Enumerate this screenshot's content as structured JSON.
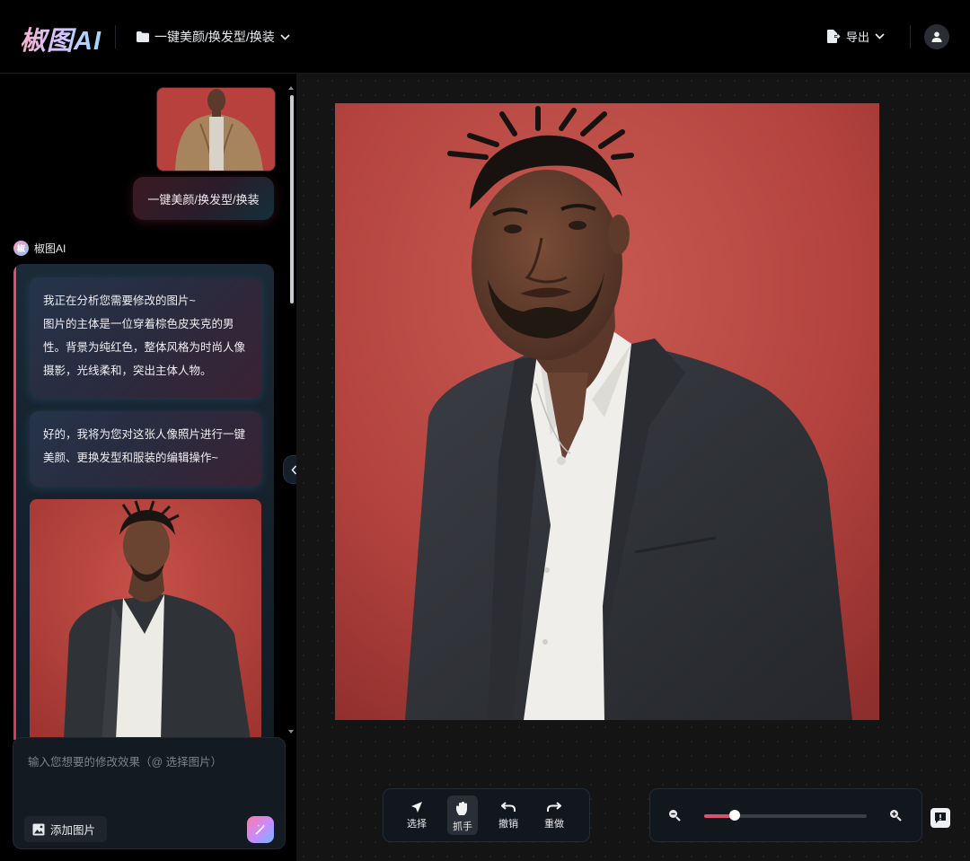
{
  "app": {
    "logo": "椒图AI"
  },
  "header": {
    "project_label": "一键美颜/换发型/换装",
    "export_label": "导出"
  },
  "chat": {
    "user_message": "一键美颜/换发型/换装",
    "bot_name": "椒图AI",
    "bot_messages": [
      "我正在分析您需要修改的图片~\n图片的主体是一位穿着棕色皮夹克的男性。背景为纯红色，整体风格为时尚人像摄影，光线柔和，突出主体人物。",
      "好的，我将为您对这张人像照片进行一键美颜、更换发型和服装的编辑操作~"
    ],
    "input_placeholder": "输入您想要的修改效果（@ 选择图片）",
    "add_image_label": "添加图片"
  },
  "toolbar": {
    "tools": [
      {
        "label": "选择",
        "icon": "cursor-icon"
      },
      {
        "label": "抓手",
        "icon": "hand-icon",
        "active": true
      },
      {
        "label": "撤销",
        "icon": "undo-icon"
      },
      {
        "label": "重做",
        "icon": "redo-icon"
      }
    ]
  },
  "zoom": {
    "level_fraction": 0.19
  },
  "colors": {
    "accent": "#e0506e",
    "photo_bg": "#b8433f",
    "jacket": "#2e3136"
  }
}
